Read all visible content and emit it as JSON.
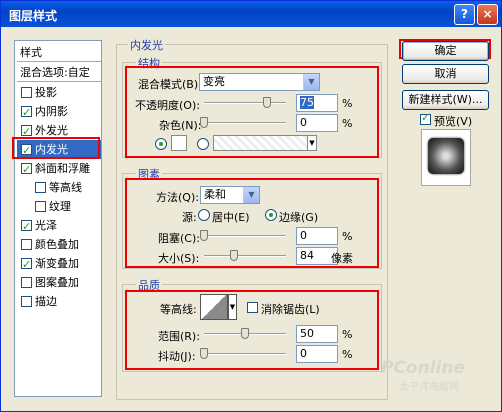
{
  "window": {
    "title": "图层样式",
    "help_glyph": "?",
    "close_glyph": "×"
  },
  "sidebar": {
    "header": "样式",
    "blend_options": "混合选项:自定",
    "items": [
      {
        "label": "投影",
        "checked": false
      },
      {
        "label": "内阴影",
        "checked": true
      },
      {
        "label": "外发光",
        "checked": true
      },
      {
        "label": "内发光",
        "checked": true,
        "selected": true
      },
      {
        "label": "斜面和浮雕",
        "checked": true
      },
      {
        "label": "等高线",
        "checked": false,
        "sub": true
      },
      {
        "label": "纹理",
        "checked": false,
        "sub": true
      },
      {
        "label": "光泽",
        "checked": true
      },
      {
        "label": "颜色叠加",
        "checked": false
      },
      {
        "label": "渐变叠加",
        "checked": true
      },
      {
        "label": "图案叠加",
        "checked": false
      },
      {
        "label": "描边",
        "checked": false
      }
    ]
  },
  "panel": {
    "title": "内发光",
    "structure": {
      "title": "结构",
      "blend_mode_label": "混合模式(B):",
      "blend_mode_value": "变亮",
      "opacity_label": "不透明度(O):",
      "opacity_value": "75",
      "opacity_unit": "%",
      "noise_label": "杂色(N):",
      "noise_value": "0",
      "noise_unit": "%"
    },
    "elements": {
      "title": "图素",
      "method_label": "方法(Q):",
      "method_value": "柔和",
      "source_label": "源:",
      "source_center": "居中(E)",
      "source_edge": "边缘(G)",
      "choke_label": "阻塞(C):",
      "choke_value": "0",
      "choke_unit": "%",
      "size_label": "大小(S):",
      "size_value": "84",
      "size_unit": "像素"
    },
    "quality": {
      "title": "品质",
      "contour_label": "等高线:",
      "antialias_label": "消除锯齿(L)",
      "range_label": "范围(R):",
      "range_value": "50",
      "range_unit": "%",
      "jitter_label": "抖动(J):",
      "jitter_value": "0",
      "jitter_unit": "%"
    }
  },
  "buttons": {
    "ok": "确定",
    "cancel": "取消",
    "new_style": "新建样式(W)...",
    "preview": "预览(V)"
  },
  "watermark": {
    "brand": "PConline",
    "sub": "太平洋电脑网"
  },
  "colors": {
    "highlight": "#e00000",
    "selection": "#316ac5",
    "title_bar": "#0a5fe8"
  }
}
